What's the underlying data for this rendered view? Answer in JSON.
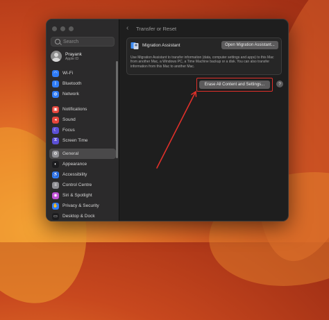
{
  "sidebar": {
    "search_placeholder": "Search",
    "user": {
      "name": "Prayank",
      "subtitle": "Apple ID"
    },
    "group1": [
      {
        "label": "Wi-Fi",
        "icon": "wifi-icon",
        "color": "#2f7cf6",
        "glyph": "◠"
      },
      {
        "label": "Bluetooth",
        "icon": "bluetooth-icon",
        "color": "#2f7cf6",
        "glyph": "ᛒ"
      },
      {
        "label": "Network",
        "icon": "network-icon",
        "color": "#2f7cf6",
        "glyph": "◍"
      }
    ],
    "group2": [
      {
        "label": "Notifications",
        "icon": "notifications-icon",
        "color": "#e5453c",
        "glyph": "▣"
      },
      {
        "label": "Sound",
        "icon": "sound-icon",
        "color": "#e5453c",
        "glyph": "◂"
      },
      {
        "label": "Focus",
        "icon": "focus-icon",
        "color": "#5b4fd6",
        "glyph": "☾"
      },
      {
        "label": "Screen Time",
        "icon": "screen-time-icon",
        "color": "#5b4fd6",
        "glyph": "⧖"
      }
    ],
    "group3": [
      {
        "label": "General",
        "icon": "general-gear-icon",
        "color": "#8e8e93",
        "glyph": "⚙",
        "active": true
      },
      {
        "label": "Appearance",
        "icon": "appearance-icon",
        "color": "#1c1c1e",
        "glyph": "◐"
      },
      {
        "label": "Accessibility",
        "icon": "accessibility-icon",
        "color": "#2f7cf6",
        "glyph": "♿"
      },
      {
        "label": "Control Centre",
        "icon": "control-centre-icon",
        "color": "#8e8e93",
        "glyph": "≡"
      },
      {
        "label": "Siri & Spotlight",
        "icon": "siri-icon",
        "color": "#c04fd6",
        "glyph": "◉"
      },
      {
        "label": "Privacy & Security",
        "icon": "privacy-hand-icon",
        "color": "#2f7cf6",
        "glyph": "✋"
      },
      {
        "label": "Desktop & Dock",
        "icon": "desktop-dock-icon",
        "color": "#1c1c1e",
        "glyph": "▭"
      }
    ]
  },
  "content": {
    "title": "Transfer or Reset",
    "migration": {
      "title": "Migration Assistant",
      "button": "Open Migration Assistant...",
      "description": "Use Migration Assistant to transfer information (data, computer settings and apps) to this Mac from another Mac, a Windows PC, a Time Machine backup or a disk. You can also transfer information from this Mac to another Mac."
    },
    "erase_button": "Erase All Content and Settings...",
    "help": "?"
  },
  "colors": {
    "highlight": "#e0302a",
    "accent": "#2f7cf6"
  }
}
